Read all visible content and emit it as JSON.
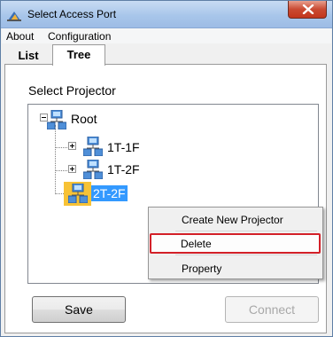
{
  "window": {
    "title": "Select Access Port"
  },
  "menubar": {
    "items": [
      "About",
      "Configuration"
    ]
  },
  "tabs": [
    {
      "label": "List",
      "selected": false
    },
    {
      "label": "Tree",
      "selected": true
    }
  ],
  "panel": {
    "section_label": "Select Projector"
  },
  "tree": {
    "root": {
      "label": "Root",
      "expanded": true
    },
    "children": [
      {
        "label": "1T-1F",
        "expanded": false,
        "selected": false
      },
      {
        "label": "1T-2F",
        "expanded": false,
        "selected": false
      },
      {
        "label": "2T-2F",
        "expanded": false,
        "selected": true
      }
    ]
  },
  "context_menu": {
    "items": [
      "Create New Projector",
      "Delete",
      "Property"
    ],
    "highlighted": "Delete"
  },
  "buttons": {
    "save": "Save",
    "connect": "Connect",
    "connect_enabled": false
  },
  "colors": {
    "highlight_border": "#d32028",
    "selection_blue": "#3399ff",
    "selected_icon_bg": "#f7c236"
  }
}
